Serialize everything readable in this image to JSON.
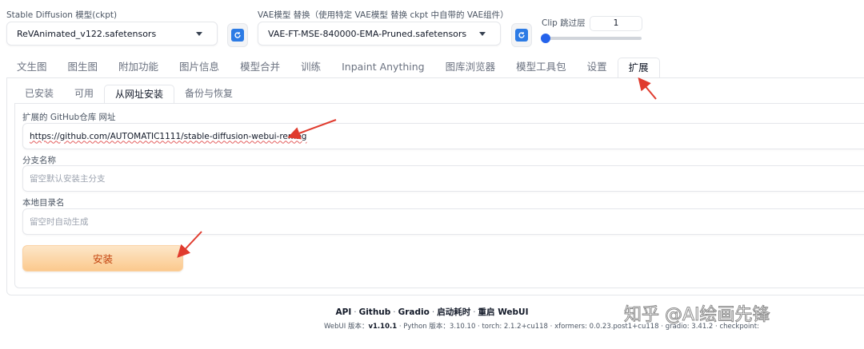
{
  "checkpoint": {
    "label": "Stable Diffusion 模型(ckpt)",
    "value": "ReVAnimated_v122.safetensors"
  },
  "vae": {
    "label": "VAE模型 替换（使用特定 VAE模型 替换 ckpt 中自带的 VAE组件）",
    "value": "VAE-FT-MSE-840000-EMA-Pruned.safetensors"
  },
  "clip": {
    "label": "Clip 跳过层",
    "value": "1",
    "slider_fraction": 0.0
  },
  "tabs": [
    {
      "label": "文生图"
    },
    {
      "label": "图生图"
    },
    {
      "label": "附加功能"
    },
    {
      "label": "图片信息"
    },
    {
      "label": "模型合并"
    },
    {
      "label": "训练"
    },
    {
      "label": "Inpaint Anything"
    },
    {
      "label": "图库浏览器"
    },
    {
      "label": "模型工具包"
    },
    {
      "label": "设置"
    },
    {
      "label": "扩展"
    }
  ],
  "subtabs": [
    {
      "label": "已安装"
    },
    {
      "label": "可用"
    },
    {
      "label": "从网址安装"
    },
    {
      "label": "备份与恢复"
    }
  ],
  "form": {
    "url_label": "扩展的 GitHub仓库 网址",
    "url_value": "https://github.com/AUTOMATIC1111/stable-diffusion-webui-rembg",
    "branch_label": "分支名称",
    "branch_placeholder": "留空默认安装主分支",
    "dir_label": "本地目录名",
    "dir_placeholder": "留空时自动生成",
    "install_label": "安装"
  },
  "footer": {
    "links": [
      "API",
      "Github",
      "Gradio",
      "启动耗时",
      "重启 WebUI"
    ],
    "webui_label": "WebUI 版本：",
    "webui_version": "v1.10.1",
    "python_label": "Python 版本：",
    "python_version": "3.10.10",
    "torch_label": "torch: 2.1.2+cu118",
    "xformers_label": "xformers: 0.0.23.post1+cu118",
    "gradio_label": "gradio: 3.41.2",
    "checkpoint_label": "checkpoint:"
  },
  "watermark": "知乎 @AI绘画先锋",
  "colors": {
    "accent": "#2563eb",
    "install_text": "#c2410c",
    "arrow": "#e03b2e"
  }
}
